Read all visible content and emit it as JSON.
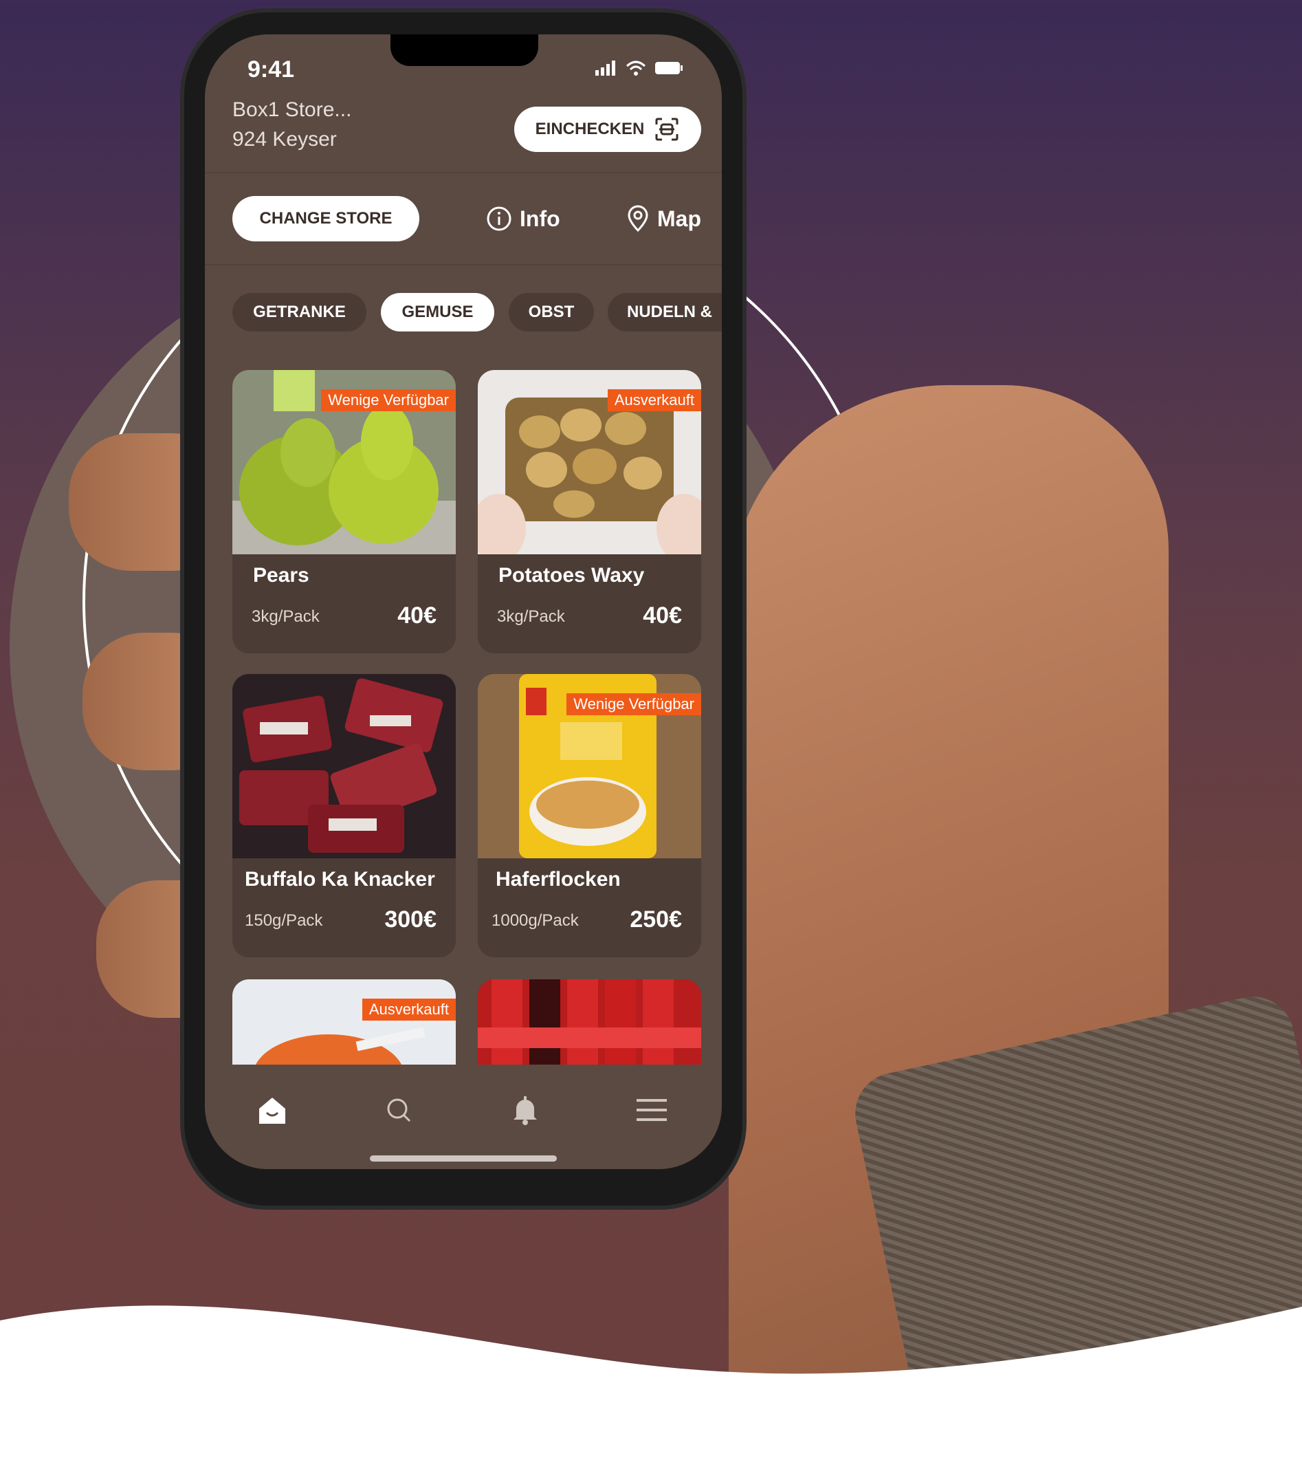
{
  "status_bar": {
    "time": "9:41"
  },
  "header": {
    "store_name": "Box1 Store...",
    "store_address": "924 Keyser",
    "checkin_label": "EINCHECKEN"
  },
  "actions": {
    "change_store_label": "CHANGE STORE",
    "info_label": "Info",
    "map_label": "Map"
  },
  "categories": [
    {
      "label": "GETRANKE",
      "active": false
    },
    {
      "label": "GEMUSE",
      "active": true
    },
    {
      "label": "OBST",
      "active": false
    },
    {
      "label": "NUDELN &",
      "active": false
    }
  ],
  "products": [
    {
      "name": "Pears",
      "unit": "3kg/Pack",
      "price": "40€",
      "badge": "Wenige Verfügbar"
    },
    {
      "name": "Potatoes Waxy",
      "unit": "3kg/Pack",
      "price": "40€",
      "badge": "Ausverkauft"
    },
    {
      "name": "Buffalo Ka Knacker",
      "unit": "150g/Pack",
      "price": "300€",
      "badge": ""
    },
    {
      "name": "Haferflocken",
      "unit": "1000g/Pack",
      "price": "250€",
      "badge": "Wenige Verfügbar"
    }
  ],
  "partial_products": [
    {
      "badge": "Ausverkauft"
    },
    {
      "badge": ""
    }
  ],
  "tabbar": {
    "icons": [
      "home-icon",
      "search-icon",
      "bell-icon",
      "menu-icon"
    ]
  },
  "colors": {
    "screen_bg": "#5b4a42",
    "card_bg": "#4b3c35",
    "badge": "#f05a18",
    "chip": "#4a3b34"
  }
}
